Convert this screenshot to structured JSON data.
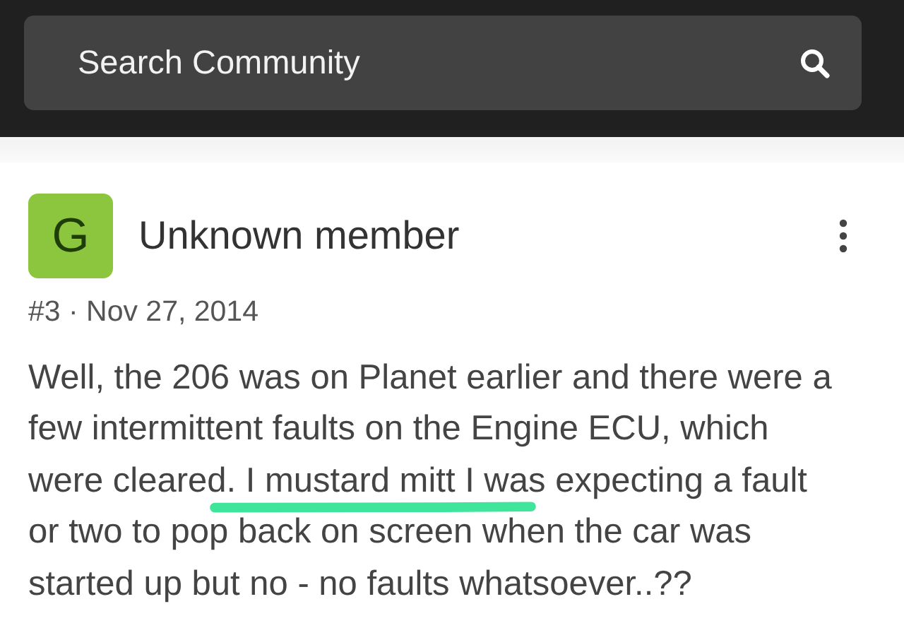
{
  "search": {
    "placeholder": "Search Community"
  },
  "post": {
    "avatar_letter": "G",
    "author": "Unknown member",
    "meta": "#3 · Nov 27, 2014",
    "lines": [
      "Well, the 206 was on Planet earlier and there were a",
      "few intermittent faults on the Engine ECU, which",
      "were cleared. I mustard mitt I was expecting a fault",
      "or two to pop back on screen when the car was",
      "started up but no - no faults whatsoever..??"
    ]
  }
}
